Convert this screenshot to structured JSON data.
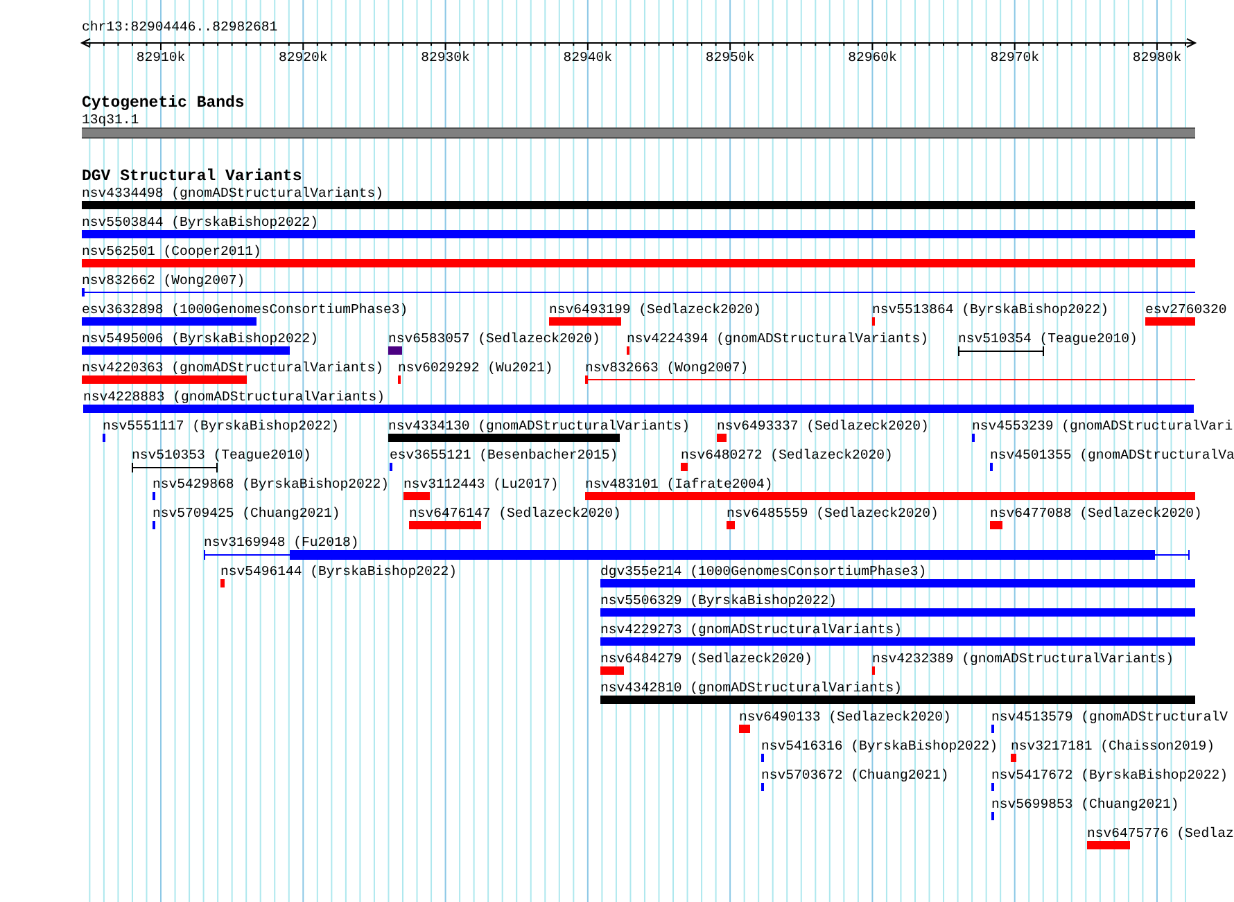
{
  "ruler": {
    "locus": "chr13:82904446..82982681",
    "ticks": [
      "82910k",
      "82920k",
      "82930k",
      "82940k",
      "82950k",
      "82960k",
      "82970k",
      "82980k"
    ]
  },
  "cytogenetic_bands": {
    "title": "Cytogenetic Bands",
    "band": "13q31.1"
  },
  "dgv": {
    "title": "DGV Structural Variants",
    "lanes": [
      {
        "features": [
          {
            "label": "nsv4334498 (gnomADStructuralVariants)",
            "kind": "bar",
            "color": "#000000"
          }
        ]
      },
      {
        "features": [
          {
            "label": "nsv5503844 (ByrskaBishop2022)",
            "kind": "bar",
            "color": "#0000ff"
          }
        ]
      },
      {
        "features": [
          {
            "label": "nsv562501 (Cooper2011)",
            "kind": "bar",
            "color": "#ff0000"
          }
        ]
      },
      {
        "features": [
          {
            "label": "nsv832662 (Wong2007)",
            "kind": "line",
            "color": "#0000ff"
          }
        ]
      },
      {
        "features": [
          {
            "label": "esv3632898 (1000GenomesConsortiumPhase3)",
            "kind": "bar",
            "color": "#0000ff"
          },
          {
            "label": "nsv6493199 (Sedlazeck2020)",
            "kind": "bar",
            "color": "#ff0000"
          },
          {
            "label": "nsv5513864 (ByrskaBishop2022)",
            "kind": "bar",
            "color": "#ff0000"
          },
          {
            "label": "esv2760320",
            "kind": "bar",
            "color": "#ff0000"
          }
        ]
      },
      {
        "features": [
          {
            "label": "nsv5495006 (ByrskaBishop2022)",
            "kind": "bar",
            "color": "#0000ff"
          },
          {
            "label": "nsv6583057 (Sedlazeck2020)",
            "kind": "bar",
            "color": "#4b0082"
          },
          {
            "label": "nsv4224394 (gnomADStructuralVariants)",
            "kind": "bar",
            "color": "#ff0000"
          },
          {
            "label": "nsv510354 (Teague2010)",
            "kind": "capped",
            "color": "#000000"
          }
        ]
      },
      {
        "features": [
          {
            "label": "nsv4220363 (gnomADStructuralVariants)",
            "kind": "bar",
            "color": "#ff0000"
          },
          {
            "label": "nsv6029292 (Wu2021)",
            "kind": "bar",
            "color": "#ff0000"
          },
          {
            "label": "nsv832663 (Wong2007)",
            "kind": "line",
            "color": "#ff0000"
          }
        ]
      },
      {
        "features": [
          {
            "label": "nsv4228883 (gnomADStructuralVariants)",
            "kind": "bar",
            "color": "#0000ff"
          }
        ]
      },
      {
        "features": [
          {
            "label": "nsv5551117 (ByrskaBishop2022)",
            "kind": "bar",
            "color": "#0000ff"
          },
          {
            "label": "nsv4334130 (gnomADStructuralVariants)",
            "kind": "bar",
            "color": "#000000"
          },
          {
            "label": "nsv6493337 (Sedlazeck2020)",
            "kind": "bar",
            "color": "#ff0000"
          },
          {
            "label": "nsv4553239 (gnomADStructuralVari",
            "kind": "bar",
            "color": "#0000ff"
          }
        ]
      },
      {
        "features": [
          {
            "label": "nsv510353 (Teague2010)",
            "kind": "capped",
            "color": "#000000"
          },
          {
            "label": "esv3655121 (Besenbacher2015)",
            "kind": "bar",
            "color": "#0000ff"
          },
          {
            "label": "nsv6480272 (Sedlazeck2020)",
            "kind": "bar",
            "color": "#ff0000"
          },
          {
            "label": "nsv4501355 (gnomADStructuralVa",
            "kind": "bar",
            "color": "#0000ff"
          }
        ]
      },
      {
        "features": [
          {
            "label": "nsv5429868 (ByrskaBishop2022)",
            "kind": "bar",
            "color": "#0000ff"
          },
          {
            "label": "nsv3112443 (Lu2017)",
            "kind": "bar",
            "color": "#ff0000"
          },
          {
            "label": "nsv483101 (Iafrate2004)",
            "kind": "bar",
            "color": "#ff0000"
          }
        ]
      },
      {
        "features": [
          {
            "label": "nsv5709425 (Chuang2021)",
            "kind": "bar",
            "color": "#0000ff"
          },
          {
            "label": "nsv6476147 (Sedlazeck2020)",
            "kind": "bar",
            "color": "#ff0000"
          },
          {
            "label": "nsv6485559 (Sedlazeck2020)",
            "kind": "bar",
            "color": "#ff0000"
          },
          {
            "label": "nsv6477088 (Sedlazeck2020)",
            "kind": "bar",
            "color": "#ff0000"
          }
        ]
      },
      {
        "features": [
          {
            "label": "nsv3169948 (Fu2018)",
            "kind": "capped",
            "color": "#0000ff"
          }
        ]
      },
      {
        "features": [
          {
            "label": "nsv5496144 (ByrskaBishop2022)",
            "kind": "bar",
            "color": "#ff0000"
          },
          {
            "label": "dgv355e214 (1000GenomesConsortiumPhase3)",
            "kind": "bar",
            "color": "#0000ff"
          }
        ]
      },
      {
        "features": [
          {
            "label": "nsv5506329 (ByrskaBishop2022)",
            "kind": "bar",
            "color": "#0000ff"
          }
        ]
      },
      {
        "features": [
          {
            "label": "nsv4229273 (gnomADStructuralVariants)",
            "kind": "bar",
            "color": "#0000ff"
          }
        ]
      },
      {
        "features": [
          {
            "label": "nsv6484279 (Sedlazeck2020)",
            "kind": "bar",
            "color": "#ff0000"
          },
          {
            "label": "nsv4232389 (gnomADStructuralVariants)",
            "kind": "bar",
            "color": "#ff0000"
          }
        ]
      },
      {
        "features": [
          {
            "label": "nsv4342810 (gnomADStructuralVariants)",
            "kind": "bar",
            "color": "#000000"
          }
        ]
      },
      {
        "features": [
          {
            "label": "nsv6490133 (Sedlazeck2020)",
            "kind": "bar",
            "color": "#ff0000"
          },
          {
            "label": "nsv4513579 (gnomADStructuralV",
            "kind": "bar",
            "color": "#0000ff"
          }
        ]
      },
      {
        "features": [
          {
            "label": "nsv5416316 (ByrskaBishop2022)",
            "kind": "bar",
            "color": "#0000ff"
          },
          {
            "label": "nsv3217181 (Chaisson2019)",
            "kind": "bar",
            "color": "#ff0000"
          }
        ]
      },
      {
        "features": [
          {
            "label": "nsv5703672 (Chuang2021)",
            "kind": "bar",
            "color": "#0000ff"
          },
          {
            "label": "nsv5417672 (ByrskaBishop2022)",
            "kind": "bar",
            "color": "#0000ff"
          }
        ]
      },
      {
        "features": [
          {
            "label": "nsv5699853 (Chuang2021)",
            "kind": "bar",
            "color": "#0000ff"
          }
        ]
      },
      {
        "features": [
          {
            "label": "nsv6475776 (Sedlaz",
            "kind": "bar",
            "color": "#ff0000"
          }
        ]
      }
    ]
  }
}
